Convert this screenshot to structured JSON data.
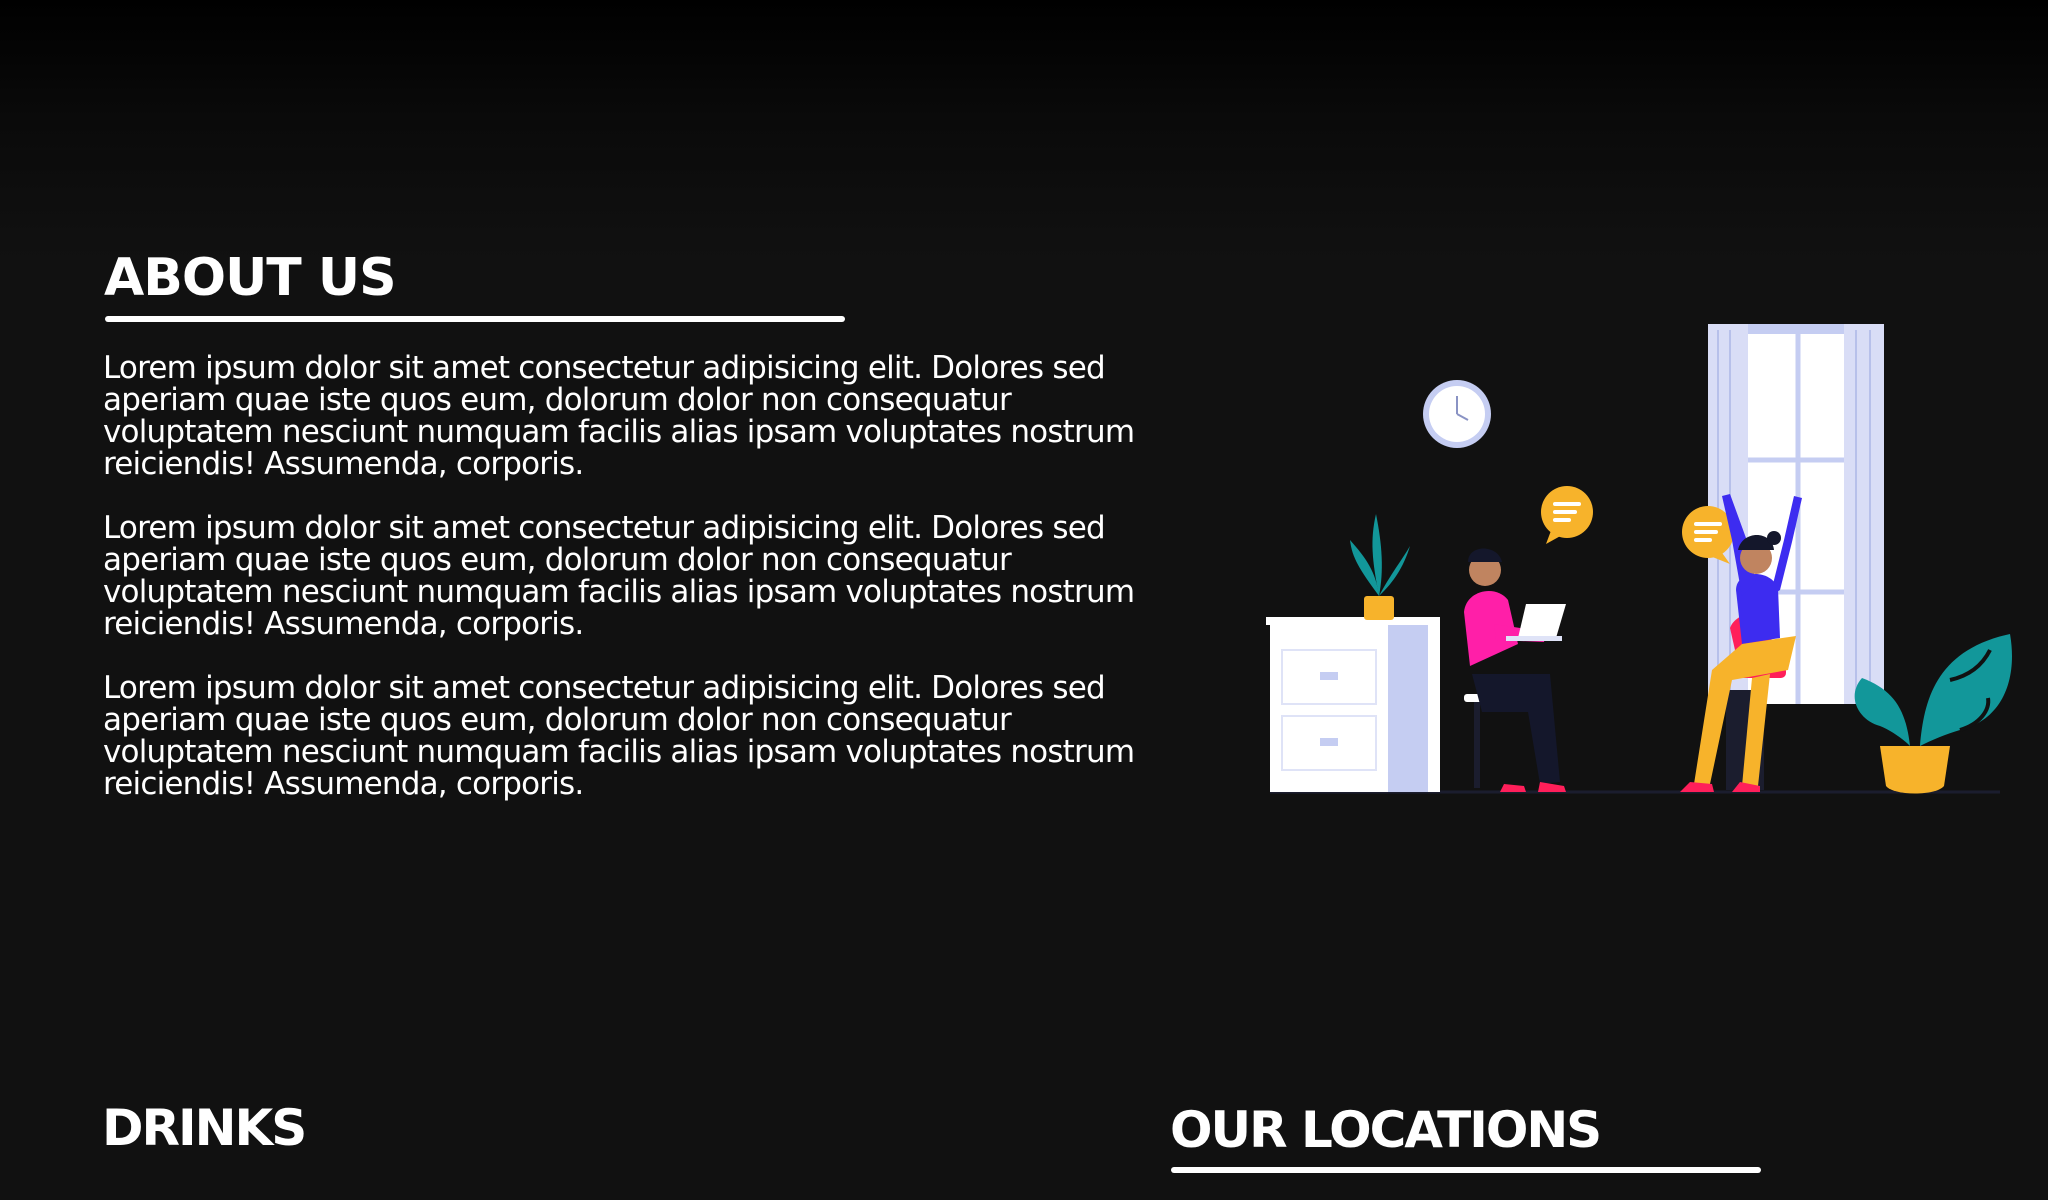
{
  "about": {
    "heading": "ABOUT US",
    "paragraphs": [
      "Lorem ipsum dolor sit amet consectetur adipisicing elit. Dolores sed aperiam quae iste quos eum, dolorum dolor non consequatur voluptatem nesciunt numquam facilis alias ipsam voluptates nostrum reiciendis! Assumenda, corporis.",
      "Lorem ipsum dolor sit amet consectetur adipisicing elit. Dolores sed aperiam quae iste quos eum, dolorum dolor non consequatur voluptatem nesciunt numquam facilis alias ipsam voluptates nostrum reiciendis! Assumenda, corporis.",
      "Lorem ipsum dolor sit amet consectetur adipisicing elit. Dolores sed aperiam quae iste quos eum, dolorum dolor non consequatur voluptatem nesciunt numquam facilis alias ipsam voluptates nostrum reiciendis! Assumenda, corporis."
    ],
    "illustration_icon": "office-chat-illustration"
  },
  "drinks": {
    "heading": "DRINKS"
  },
  "locations": {
    "heading": "OUR LOCATIONS"
  },
  "colors": {
    "background": "#111111",
    "text": "#ffffff",
    "accent_yellow": "#f7b32b",
    "accent_teal": "#12979a",
    "accent_pink": "#ff1fa8",
    "accent_blue": "#3d2cf0"
  }
}
